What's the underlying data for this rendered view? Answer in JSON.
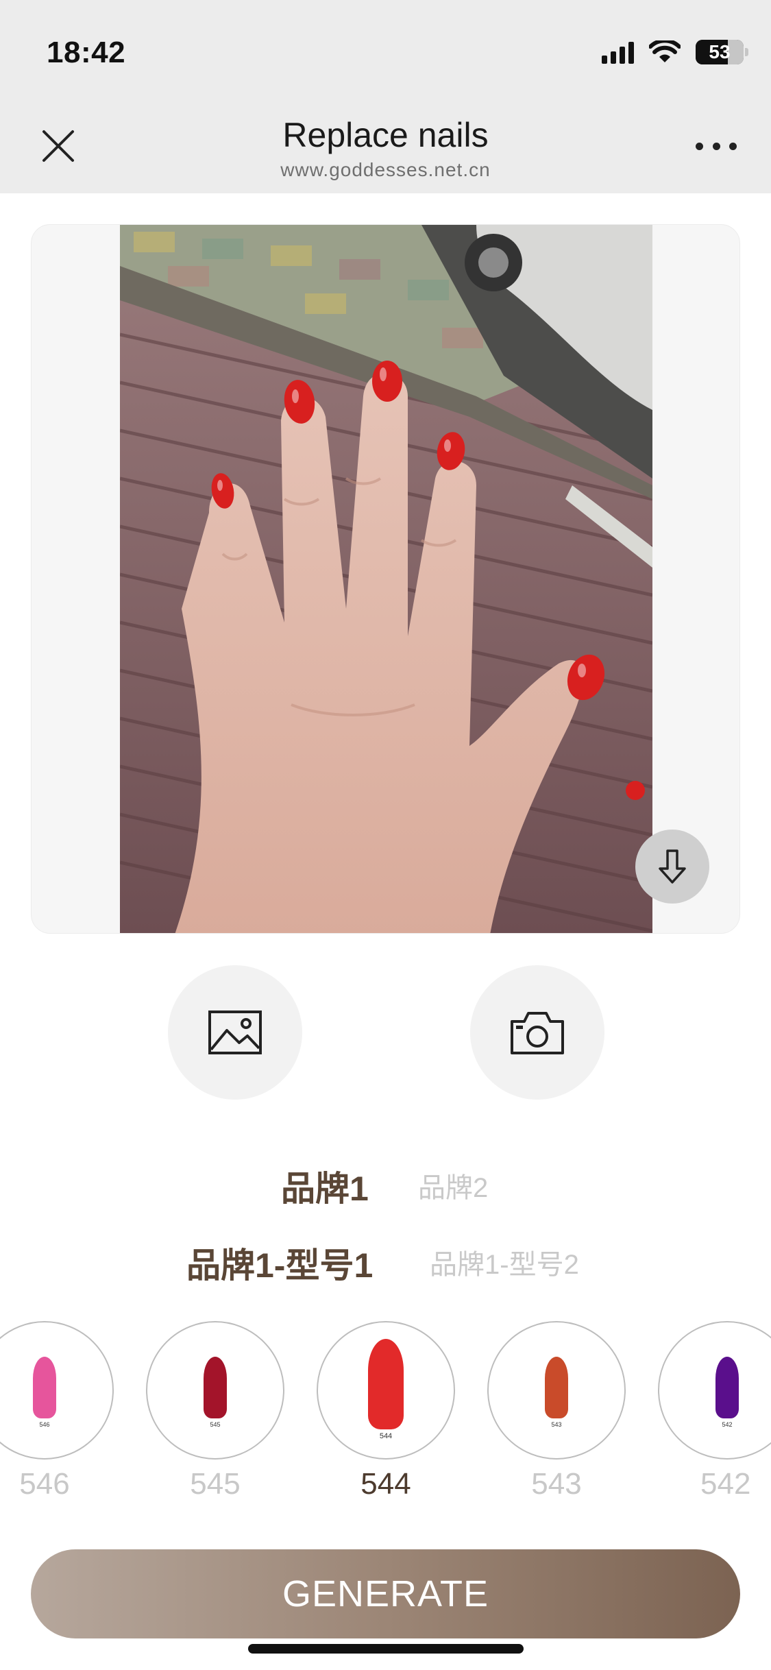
{
  "status_bar": {
    "time": "18:42",
    "battery": "53"
  },
  "header": {
    "title": "Replace nails",
    "url": "www.goddesses.net.cn"
  },
  "brands": [
    {
      "label": "品牌1",
      "selected": true
    },
    {
      "label": "品牌2",
      "selected": false
    }
  ],
  "models": [
    {
      "label": "品牌1-型号1",
      "selected": true
    },
    {
      "label": "品牌1-型号2",
      "selected": false
    }
  ],
  "swatches": [
    {
      "code": "546",
      "color": "#e6559c",
      "selected": false
    },
    {
      "code": "545",
      "color": "#a3142a",
      "selected": false
    },
    {
      "code": "544",
      "color": "#e22a2a",
      "selected": true
    },
    {
      "code": "543",
      "color": "#c94b2a",
      "selected": false
    },
    {
      "code": "542",
      "color": "#5a0f8c",
      "selected": false
    }
  ],
  "generate_label": "GENERATE",
  "colors": {
    "accent_text": "#5a4636",
    "button_gradient_start": "#b6a79c",
    "button_gradient_end": "#7c6352",
    "nail_polish": "#d8201f"
  },
  "icons": {
    "close": "close-icon",
    "more": "more-icon",
    "download": "download-arrow-icon",
    "gallery": "image-icon",
    "camera": "camera-icon"
  }
}
